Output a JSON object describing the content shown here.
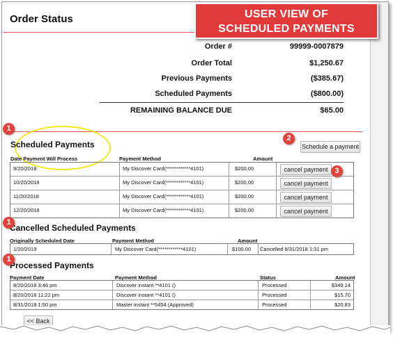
{
  "page": {
    "title": "Order Status"
  },
  "callout": {
    "line1": "USER VIEW OF",
    "line2": "SCHEDULED PAYMENTS"
  },
  "summary": {
    "rows": [
      {
        "label": "Order #",
        "value": "99999-0007879"
      },
      {
        "label": "Order Total",
        "value": "$1,250.67"
      },
      {
        "label": "Previous Payments",
        "value": "($385.67)"
      },
      {
        "label": "Scheduled Payments",
        "value": "($800.00)"
      },
      {
        "label": "REMAINING BALANCE DUE",
        "value": "$65.00"
      }
    ]
  },
  "markers": {
    "m1": "1",
    "m2": "2",
    "m3": "3"
  },
  "scheduled": {
    "title": "Scheduled Payments",
    "schedule_button": "Schedule a payment",
    "columns": {
      "date": "Date Payment Will Process",
      "method": "Payment Method",
      "amount": "Amount"
    },
    "rows": [
      {
        "date": "9/20/2018",
        "method": "My Discover Card(************4101)",
        "amount": "$200.00",
        "action": "cancel payment"
      },
      {
        "date": "10/20/2018",
        "method": "My Discover Card(************4101)",
        "amount": "$200.00",
        "action": "cancel payment"
      },
      {
        "date": "11/20/2018",
        "method": "My Discover Card(************4101)",
        "amount": "$200.00",
        "action": "cancel payment"
      },
      {
        "date": "12/20/2018",
        "method": "My Discover Card(************4101)",
        "amount": "$200.00",
        "action": "cancel payment"
      }
    ]
  },
  "cancelled": {
    "title": "Cancelled Scheduled Payments",
    "columns": {
      "date": "Originally Scheduled Date",
      "method": "Payment Method",
      "amount": "Amount"
    },
    "rows": [
      {
        "date": "1/20/2019",
        "method": "My Discover Card(************4101)",
        "amount": "$100.00",
        "status": "Cancelled 8/31/2018 1:31 pm"
      }
    ]
  },
  "processed": {
    "title": "Processed Payments",
    "columns": {
      "date": "Payment Date",
      "method": "Payment Method",
      "status": "Status",
      "amount": "Amount"
    },
    "rows": [
      {
        "date": "8/20/2018 3:46 pm",
        "method": "Discover instant **4101 ()",
        "status": "Processed",
        "amount": "$349.14"
      },
      {
        "date": "8/20/2018 11:22 pm",
        "method": "Discover instant **4101 ()",
        "status": "Processed",
        "amount": "$15.70"
      },
      {
        "date": "8/31/2018 1:50 pm",
        "method": "Master instant **5454 (Approved)",
        "status": "Processed",
        "amount": "$20.83"
      }
    ]
  },
  "back_button": "<< Back"
}
